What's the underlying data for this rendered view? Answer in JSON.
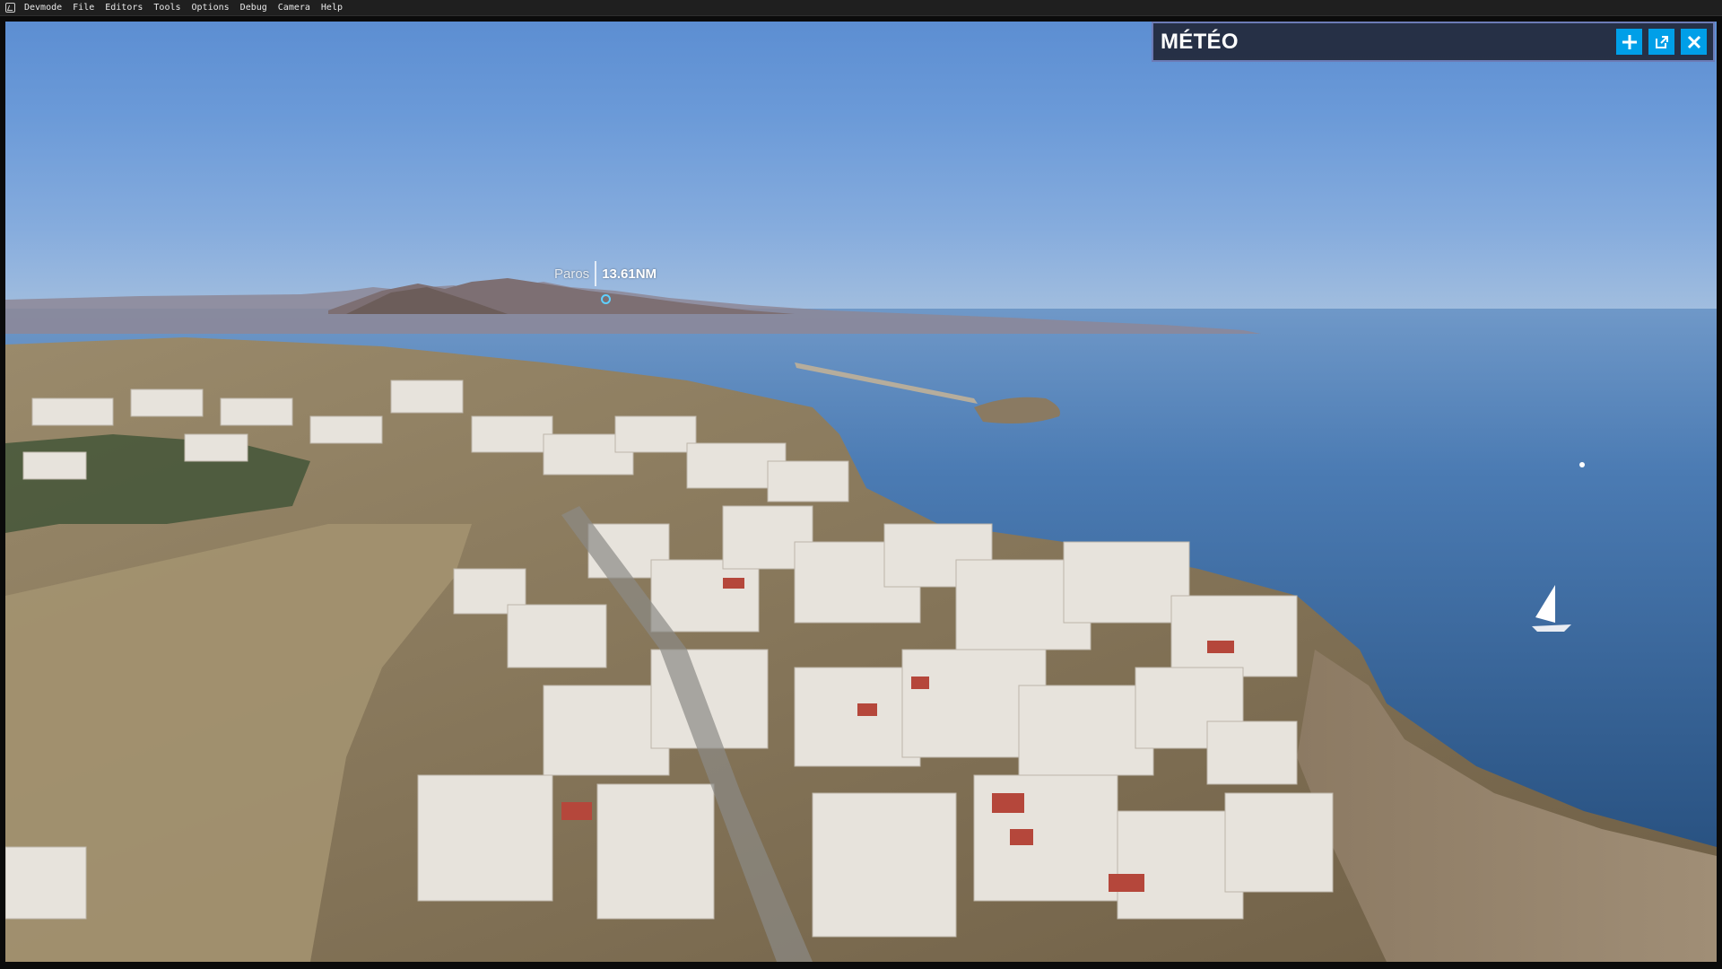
{
  "menubar": {
    "items": [
      {
        "label": "Devmode"
      },
      {
        "label": "File"
      },
      {
        "label": "Editors"
      },
      {
        "label": "Tools"
      },
      {
        "label": "Options"
      },
      {
        "label": "Debug"
      },
      {
        "label": "Camera"
      },
      {
        "label": "Help"
      }
    ]
  },
  "marker": {
    "name": "Paros",
    "distance": "13.61NM"
  },
  "meteo_panel": {
    "title": "MÉTÉO",
    "buttons": [
      {
        "icon": "plus-icon"
      },
      {
        "icon": "popout-icon"
      },
      {
        "icon": "close-icon"
      }
    ],
    "accent": "#009fe8"
  },
  "colors": {
    "sky": "#6b9ad8",
    "sea": "#2f5e95",
    "terrain": "#8f7f64",
    "buildings": "#e6e3dc"
  }
}
